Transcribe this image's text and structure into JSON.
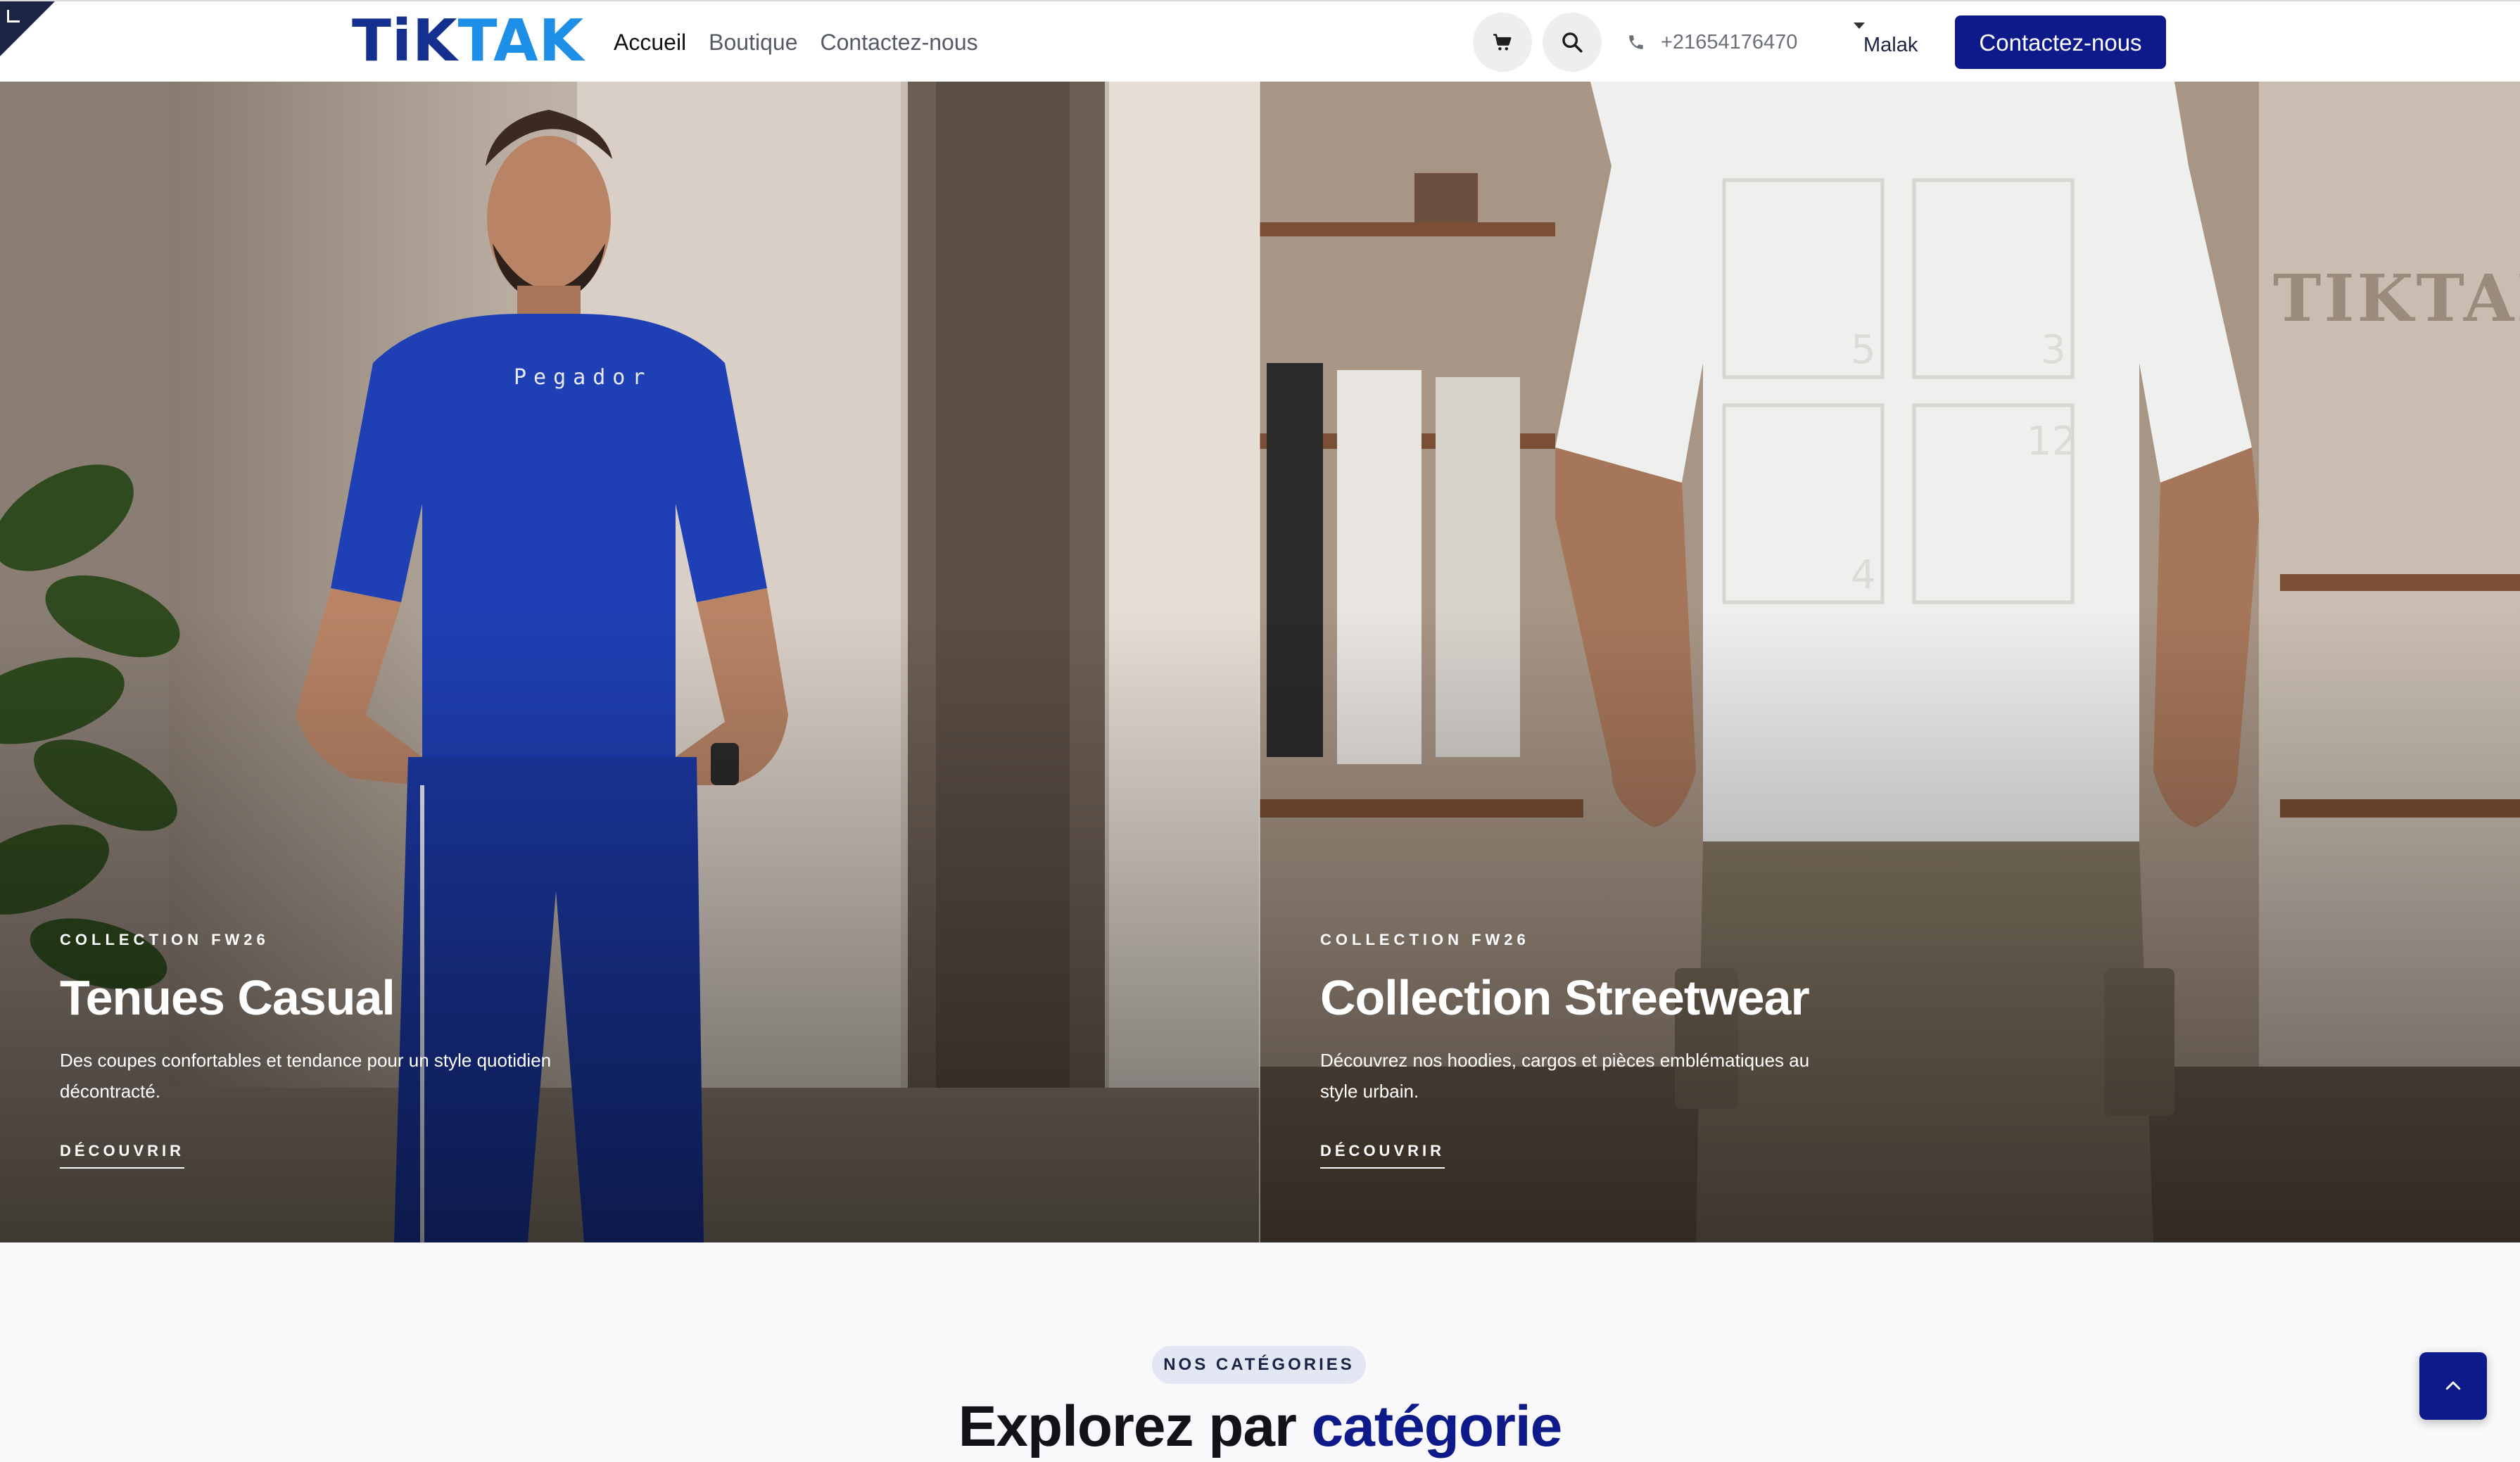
{
  "header": {
    "logo": {
      "part1": "TiK",
      "part2": "TAK"
    },
    "nav": [
      {
        "label": "Accueil",
        "active": true
      },
      {
        "label": "Boutique",
        "active": false
      },
      {
        "label": "Contactez-nous",
        "active": false
      }
    ],
    "phone": "+21654176470",
    "user_name": "Malak",
    "cta_label": "Contactez-nous",
    "icons": {
      "cart": "cart-icon",
      "search": "search-icon",
      "phone": "phone-icon"
    }
  },
  "hero": {
    "slides": [
      {
        "eyebrow": "COLLECTION FW26",
        "title": "Tenues Casual",
        "description": "Des coupes confortables et tendance pour un style quotidien décontracté.",
        "link": "DÉCOUVRIR"
      },
      {
        "eyebrow": "COLLECTION FW26",
        "title": "Collection Streetwear",
        "description": "Découvrez nos hoodies, cargos et pièces emblématiques au style urbain.",
        "link": "DÉCOUVRIR"
      }
    ]
  },
  "categories": {
    "pill": "NOS CATÉGORIES",
    "title_plain": "Explorez par ",
    "title_accent": "catégorie"
  },
  "colors": {
    "brand_primary": "#0e1a8a",
    "brand_light": "#1e8fe6",
    "navbar_bg": "#ffffff",
    "page_bg": "#f9f9fb"
  }
}
